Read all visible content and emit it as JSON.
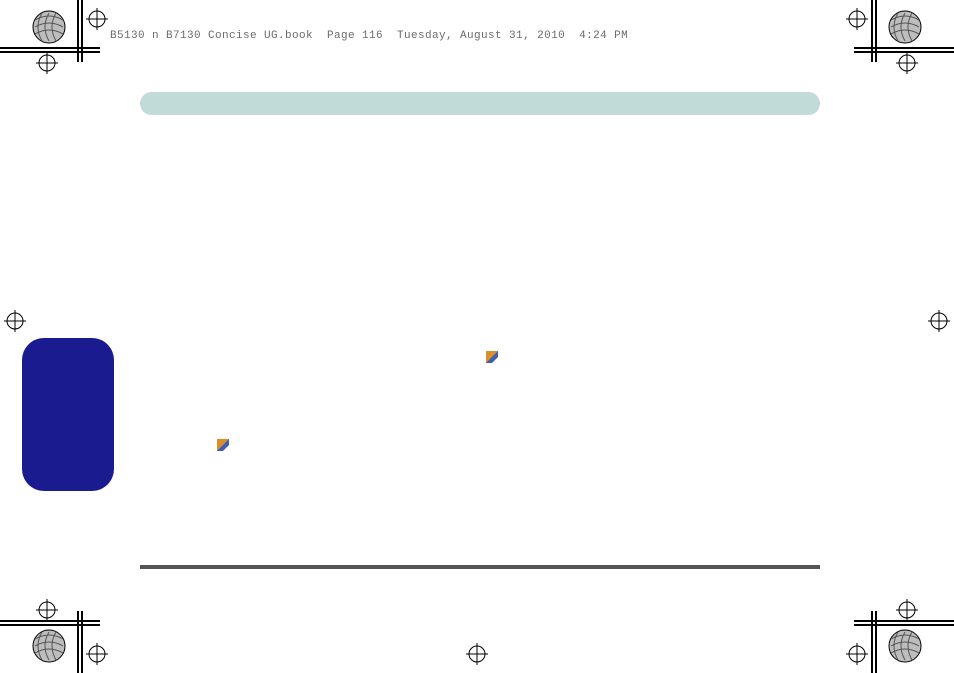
{
  "header": {
    "text": "B5130 n B7130 Concise UG.book  Page 116  Tuesday, August 31, 2010  4:24 PM"
  },
  "colors": {
    "tealBar": "#c0dbd8",
    "blueTab": "#1a1b8f",
    "rule": "#555555"
  }
}
